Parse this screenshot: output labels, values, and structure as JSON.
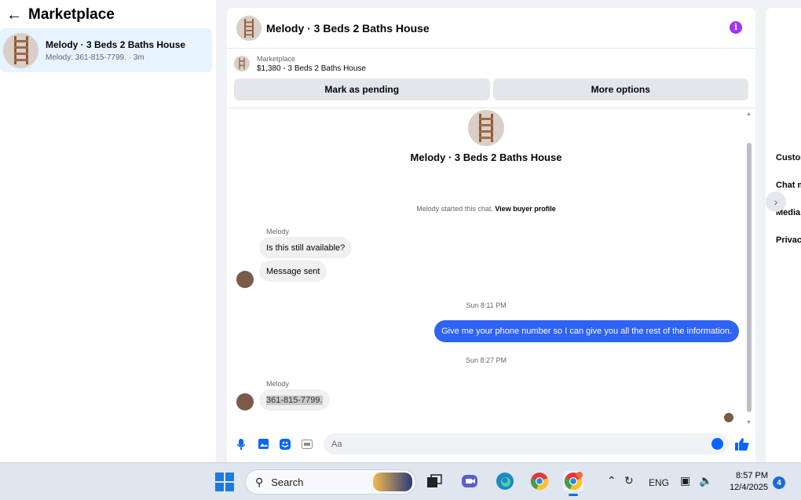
{
  "left_panel": {
    "title": "Marketplace",
    "conversation": {
      "name": "Melody · 3 Beds 2 Baths House",
      "preview": "Melody: 361-815-7799. · 3m"
    }
  },
  "chat": {
    "header_name": "Melody · 3 Beds 2 Baths House",
    "listing_label": "Marketplace",
    "listing_price_title": "$1,380 - 3 Beds 2 Baths House",
    "mark_pending_label": "Mark as pending",
    "more_options_label": "More options",
    "profile_name": "Melody · 3 Beds 2 Baths House",
    "started_text": "Melody started this chat.",
    "view_profile_label": "View buyer profile",
    "messages": [
      {
        "sender": "Melody",
        "text": "Is this still available?"
      },
      {
        "text": "Message sent"
      },
      {
        "time": "Sun 8:11 PM"
      },
      {
        "text": "Give me your phone number so I can give you all the rest of the information."
      },
      {
        "time": "Sun 8:27 PM"
      },
      {
        "sender": "Melody",
        "text": "361-815-7799."
      }
    ],
    "composer_placeholder": "Aa"
  },
  "right_panel": {
    "items": [
      "Customize chat",
      "Chat members",
      "Media & files",
      "Privacy & support"
    ]
  },
  "taskbar": {
    "search_label": "Search",
    "language": "ENG",
    "time": "8:57 PM",
    "date": "12/4/2025",
    "notification_count": "4"
  },
  "colors": {
    "accent": "#0866ff",
    "outgoing_bubble": "#2e63f5",
    "info_icon": "#a033ff",
    "selected_conversation": "#e7f3ff"
  }
}
